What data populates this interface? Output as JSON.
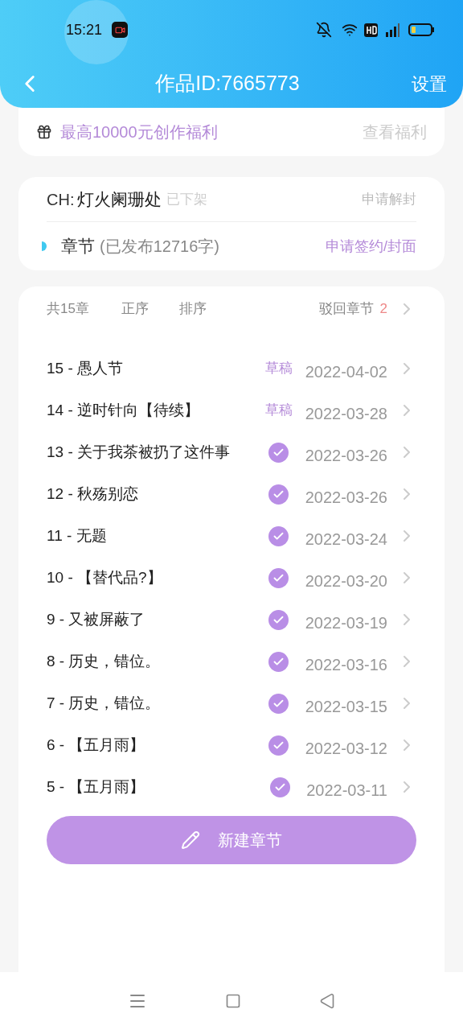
{
  "status_bar": {
    "time": "15:21"
  },
  "header": {
    "title": "作品ID:7665773",
    "action": "设置"
  },
  "welfare": {
    "text": "最高10000元创作福利",
    "link": "查看福利"
  },
  "work": {
    "prefix": "CH:",
    "name": "灯火阑珊处",
    "status": "已下架",
    "action": "申请解封",
    "section": "章节",
    "published": "(已发布12716字)",
    "sign_link": "申请签约/封面"
  },
  "toolbar": {
    "count": "共15章",
    "order": "正序",
    "sort": "排序",
    "rejected": "驳回章节",
    "rejected_count": "2"
  },
  "chapters": [
    {
      "title": "15 - 愚人节",
      "kind": "draft",
      "status": "草稿",
      "date": "2022-04-02"
    },
    {
      "title": "14 - 逆时针向【待续】",
      "kind": "draft",
      "status": "草稿",
      "date": "2022-03-28"
    },
    {
      "title": "13 - 关于我茶被扔了这件事",
      "kind": "published",
      "date": "2022-03-26"
    },
    {
      "title": "12 - 秋殇别恋",
      "kind": "published",
      "date": "2022-03-26"
    },
    {
      "title": "11 - 无题",
      "kind": "published",
      "date": "2022-03-24"
    },
    {
      "title": "10 - 【替代品?】",
      "kind": "published",
      "date": "2022-03-20"
    },
    {
      "title": "9 - 又被屏蔽了",
      "kind": "published",
      "date": "2022-03-19"
    },
    {
      "title": "8 - 历史，错位。",
      "kind": "published",
      "date": "2022-03-16"
    },
    {
      "title": "7 - 历史，错位。",
      "kind": "published",
      "date": "2022-03-15"
    },
    {
      "title": "6 - 【五月雨】",
      "kind": "published",
      "date": "2022-03-12"
    },
    {
      "title": "5 - 【五月雨】",
      "kind": "published",
      "date": "2022-03-11"
    }
  ],
  "new_button": "新建章节"
}
